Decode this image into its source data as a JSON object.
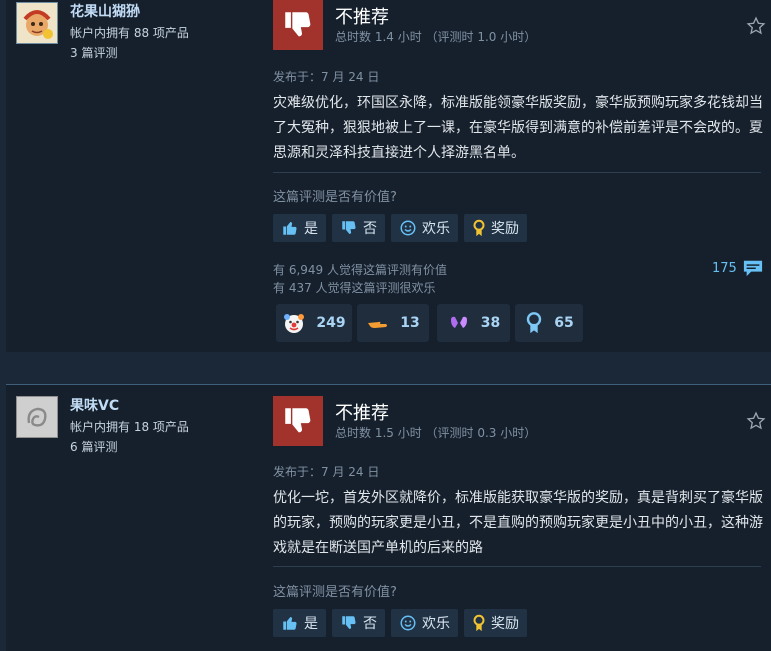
{
  "reviews": [
    {
      "user": {
        "name": "花果山猢狲",
        "products": "帐户内拥有 88 项产品",
        "reviews": "3 篇评测",
        "avatar": "monkey-king-avatar"
      },
      "verdict": "不推荐",
      "hours": "总时数 1.4 小时 （评测时 1.0 小时）",
      "posted": "发布于：7 月 24 日",
      "content": "灾难级优化，环国区永降，标准版能领豪华版奖励，豪华版预购玩家多花钱却当了大冤种，狠狠地被上了一课，在豪华版得到满意的补偿前差评是不会改的。夏思源和灵泽科技直接进个人择游黑名单。",
      "question": "这篇评测是否有价值?",
      "buttons": {
        "yes": "是",
        "no": "否",
        "funny": "欢乐",
        "award": "奖励"
      },
      "helpful": "有 6,949 人觉得这篇评测有价值",
      "funny": "有 437 人觉得这篇评测很欢乐",
      "comments": "175",
      "awards": [
        {
          "icon": "clown-face-icon",
          "count": "249"
        },
        {
          "icon": "pointing-hand-icon",
          "count": "13"
        },
        {
          "icon": "heart-hands-icon",
          "count": "38"
        },
        {
          "icon": "medal-icon",
          "count": "65"
        }
      ]
    },
    {
      "user": {
        "name": "果味VC",
        "products": "帐户内拥有 18 项产品",
        "reviews": "6 篇评测",
        "avatar": "abstract-avatar"
      },
      "verdict": "不推荐",
      "hours": "总时数 1.5 小时 （评测时 0.3 小时）",
      "posted": "发布于：7 月 24 日",
      "content": "优化一坨，首发外区就降价，标准版能获取豪华版的奖励，真是背刺买了豪华版的玩家，预购的玩家更是小丑，不是直购的预购玩家更是小丑中的小丑，这种游戏就是在断送国产单机的后来的路",
      "question": "这篇评测是否有价值?",
      "buttons": {
        "yes": "是",
        "no": "否",
        "funny": "欢乐",
        "award": "奖励"
      }
    }
  ],
  "colors": {
    "not_recommended": "#a2322c",
    "link": "#66c0f4",
    "background": "#1b2838"
  }
}
